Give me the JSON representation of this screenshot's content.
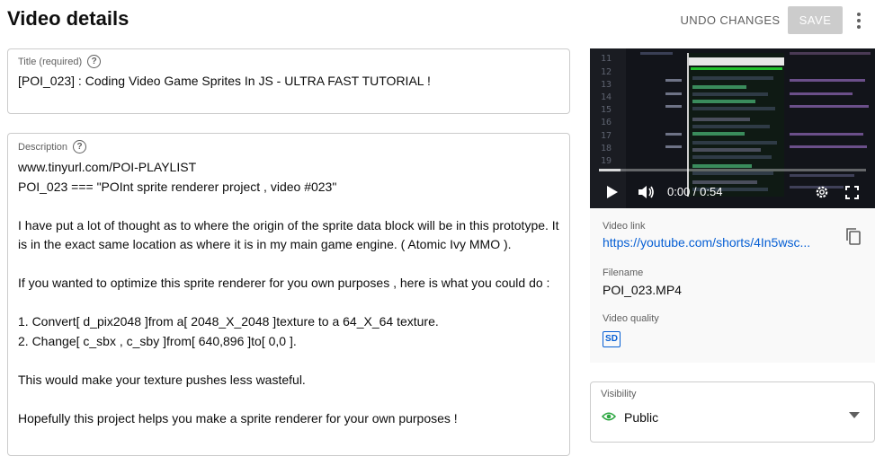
{
  "header": {
    "title": "Video details",
    "undo_label": "UNDO CHANGES",
    "save_label": "SAVE"
  },
  "title_field": {
    "label": "Title (required)",
    "value": "[POI_023] : Coding Video Game Sprites In JS - ULTRA FAST TUTORIAL !"
  },
  "description": {
    "label": "Description",
    "lines": [
      "www.tinyurl.com/POI-PLAYLIST",
      "POI_023 === \"POInt sprite renderer project , video #023\"",
      "",
      "I have put a lot of thought as to where the origin of the sprite data block will be in this prototype. It",
      "is in the exact same location as where it is in my main game engine. ( Atomic Ivy MMO ).",
      "",
      "If you wanted to optimize this sprite renderer for you own purposes , here is what you could do :",
      "",
      "1. Convert[ d_pix2048 ]from a[ 2048_X_2048 ]texture to a 64_X_64 texture.",
      "2. Change[ c_sbx , c_sby ]from[ 640,896 ]to[ 0,0 ].",
      "",
      "This would make your texture pushes less wasteful.",
      "",
      "Hopefully this project helps you make a sprite renderer for your own purposes !"
    ]
  },
  "video": {
    "time": "0:00 / 0:54",
    "progress": 0.08,
    "code_line_numbers": [
      "11",
      "12",
      "13",
      "14",
      "15",
      "16",
      "17",
      "18",
      "19"
    ],
    "link_label": "Video link",
    "link": "https://youtube.com/shorts/4In5wsc...",
    "filename_label": "Filename",
    "filename": "POI_023.MP4",
    "quality_label": "Video quality",
    "quality": "SD"
  },
  "visibility": {
    "label": "Visibility",
    "value": "Public"
  },
  "colors": {
    "accent": "#065fd4",
    "public_green": "#2ba640",
    "save_disabled": "#cccccc"
  }
}
